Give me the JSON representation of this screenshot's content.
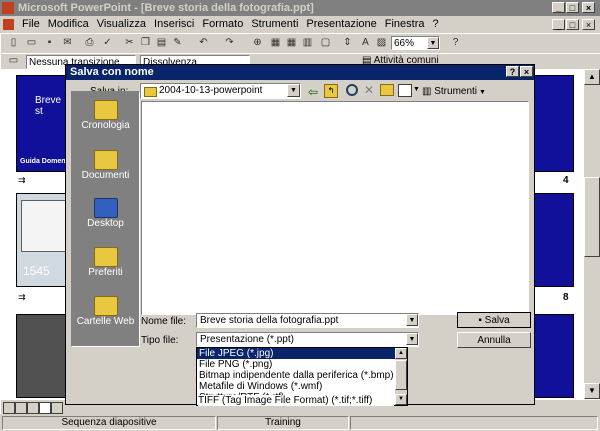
{
  "app": {
    "title": "Microsoft PowerPoint - [Breve storia della fotografia.ppt]"
  },
  "menu": [
    "File",
    "Modifica",
    "Visualizza",
    "Inserisci",
    "Formato",
    "Strumenti",
    "Presentazione",
    "Finestra",
    "?"
  ],
  "toolbar": {
    "zoom": "66%"
  },
  "toolbar2": {
    "transition": "Nessuna transizione",
    "effect": "Dissolvenza",
    "activities": "Attività comuni"
  },
  "slides": {
    "thumb1_title": "Breve st",
    "thumb1_sub": "Guida Domen",
    "thumb2_year": "1545",
    "num_4": "4",
    "num_8": "8"
  },
  "dialog": {
    "title": "Salva con nome",
    "save_in_label": "Salva in:",
    "save_in_value": "2004-10-13-powerpoint",
    "tools_label": "Strumenti",
    "places": [
      "Cronologia",
      "Documenti",
      "Desktop",
      "Preferiti",
      "Cartelle Web"
    ],
    "filename_label": "Nome file:",
    "filename_value": "Breve storia della fotografia.ppt",
    "filetype_label": "Tipo file:",
    "filetype_value": "Presentazione (*.ppt)",
    "save_button": "Salva",
    "cancel_button": "Annulla",
    "filetype_options": [
      "File JPEG (*.jpg)",
      "File PNG (*.png)",
      "Bitmap indipendente dalla periferica (*.bmp)",
      "Metafile di Windows (*.wmf)",
      "Struttura/RTF (*.rtf)",
      "TIFF (Tag Image File Format) (*.tif;*.tiff)"
    ]
  },
  "status": {
    "left": "Sequenza diapositive",
    "middle": "Training"
  }
}
